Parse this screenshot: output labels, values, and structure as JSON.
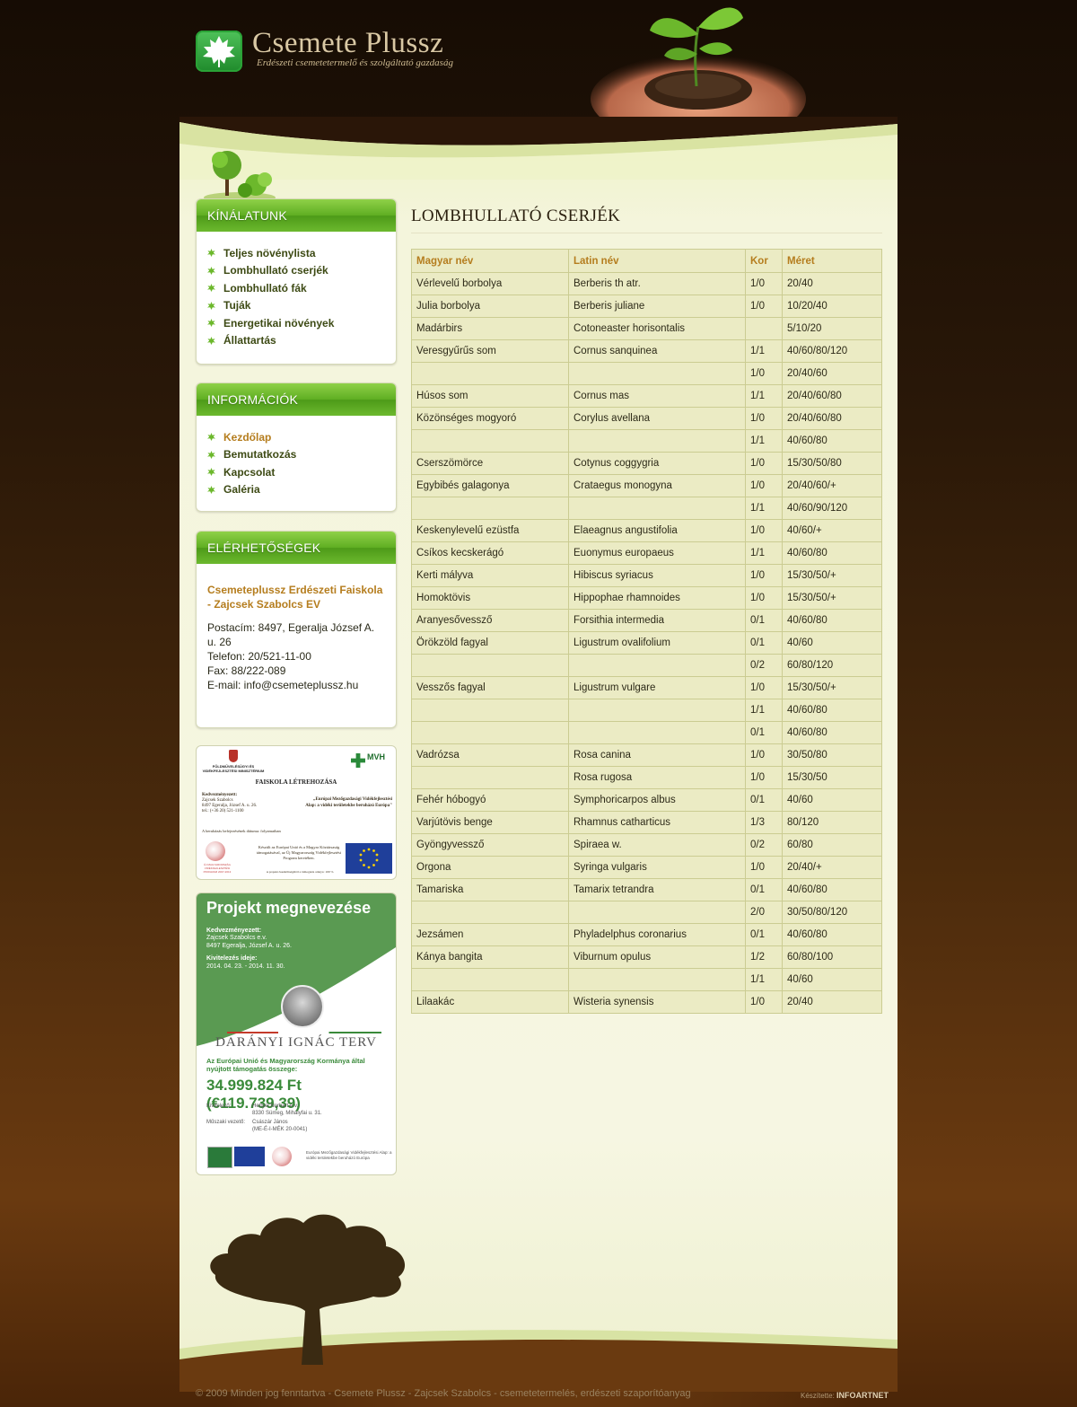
{
  "header": {
    "title": "Csemete Plussz",
    "subtitle": "Erdészeti csemetetermelő és szolgáltató gazdaság"
  },
  "colors": {
    "accent": "#b57d1e",
    "green": "#5fae22",
    "table_bg": "#ebebc4"
  },
  "sidebar": {
    "offer": {
      "title": "KÍNÁLATUNK",
      "items": [
        {
          "label": "Teljes növénylista"
        },
        {
          "label": "Lombhullató cserjék"
        },
        {
          "label": "Lombhullató fák"
        },
        {
          "label": "Tuják"
        },
        {
          "label": "Energetikai növények"
        },
        {
          "label": "Állattartás"
        }
      ]
    },
    "info": {
      "title": "INFORMÁCIÓK",
      "items": [
        {
          "label": "Kezdőlap",
          "active": true
        },
        {
          "label": "Bemutatkozás"
        },
        {
          "label": "Kapcsolat"
        },
        {
          "label": "Galéria"
        }
      ]
    },
    "contact": {
      "title": "ELÉRHETŐSÉGEK",
      "org": "Csemeteplussz Erdészeti Faiskola - Zajcsek Szabolcs EV",
      "lines": [
        "Postacím: 8497, Egeralja József A. u. 26",
        "Telefon: 20/521-11-00",
        "Fax: 88/222-089",
        "E-mail: info@csemeteplussz.hu"
      ]
    },
    "banner1": {
      "ministry": "FÖLDMŰVELÉSÜGYI ÉS VIDÉKFEJLESZTÉSI MINISZTÉRIUM",
      "mvh": "MVH",
      "heading": "FAISKOLA LÉTREHOZÁSA",
      "beneficiary_label": "Kedvezményezett:",
      "beneficiary": "Zajcsek Szabolcs",
      "address": "8497 Egeralja, József A. u. 26.",
      "phone": "tel.: (+36 20) 521-1100",
      "eu_fund": "„Európai Mezőgazdasági Vidékfejlesztési Alap: a vidéki területekbe beruházó Európa\"",
      "status": "A beruházás befejezésének dátuma: folyamatban",
      "program": "Készült az Európai Unió és a Magyar Köztársaság támogatásával, az Új Magyarország Vidékfejlesztési Program keretében.",
      "umvp": "ÚJ MAGYARORSZÁG VIDÉKFEJLESZTÉSI PROGRAM 2007-2013",
      "footnote": "A projekt összköltségéből a támogatás aránya: 100 %"
    },
    "banner2": {
      "title": "Projekt megnevezése",
      "beneficiary_label": "Kedvezményezett:",
      "beneficiary": "Zajcsek Szabolcs e.v.",
      "address": "8497 Egeralja, József A. u. 26.",
      "period_label": "Kivitelezés ideje:",
      "period": "2014. 04. 23. - 2014. 11. 30.",
      "plan": "DARÁNYI IGNÁC TERV",
      "support_text": "Az Európai Unió és Magyarország Kormánya által nyújtott támogatás összege:",
      "amount": "34.999.824 Ft (€119.739,39)",
      "contractor_label": "Kivitelező:",
      "contractor": "Hettyei Norbert e.v.",
      "contractor_addr": "8330 Sümeg, Mihályfai u. 31.",
      "tech_label": "Műszaki vezető:",
      "tech": "Császár János",
      "tech_id": "(ME-É-I-MÉK 20-0041)",
      "eu_text": "Európai Mezőgazdasági Vidékfejlesztési Alap: a vidéki területekbe beruházó Európa"
    }
  },
  "main": {
    "title": "LOMBHULLATÓ CSERJÉK",
    "columns": [
      "Magyar név",
      "Latin név",
      "Kor",
      "Méret"
    ],
    "rows": [
      [
        "Vérlevelű borbolya",
        "Berberis th atr.",
        "1/0",
        "20/40"
      ],
      [
        "Julia borbolya",
        "Berberis juliane",
        "1/0",
        "10/20/40"
      ],
      [
        "Madárbirs",
        "Cotoneaster horisontalis",
        "",
        "5/10/20"
      ],
      [
        "Veresgyűrűs som",
        "Cornus sanquinea",
        "1/1",
        "40/60/80/120"
      ],
      [
        "",
        "",
        "1/0",
        "20/40/60"
      ],
      [
        "Húsos som",
        "Cornus mas",
        "1/1",
        "20/40/60/80"
      ],
      [
        "Közönséges mogyoró",
        "Corylus avellana",
        "1/0",
        "20/40/60/80"
      ],
      [
        "",
        "",
        "1/1",
        "40/60/80"
      ],
      [
        "Cserszömörce",
        "Cotynus coggygria",
        "1/0",
        "15/30/50/80"
      ],
      [
        "Egybibés galagonya",
        "Crataegus monogyna",
        "1/0",
        "20/40/60/+"
      ],
      [
        "",
        "",
        "1/1",
        "40/60/90/120"
      ],
      [
        "Keskenylevelű ezüstfa",
        "Elaeagnus angustifolia",
        "1/0",
        "40/60/+"
      ],
      [
        "Csíkos kecskerágó",
        "Euonymus europaeus",
        "1/1",
        "40/60/80"
      ],
      [
        "Kerti mályva",
        "Hibiscus syriacus",
        "1/0",
        "15/30/50/+"
      ],
      [
        "Homoktövis",
        "Hippophae rhamnoides",
        "1/0",
        "15/30/50/+"
      ],
      [
        "Aranyesővessző",
        "Forsithia intermedia",
        "0/1",
        "40/60/80"
      ],
      [
        "Örökzöld fagyal",
        "Ligustrum ovalifolium",
        "0/1",
        "40/60"
      ],
      [
        "",
        "",
        "0/2",
        "60/80/120"
      ],
      [
        "Vesszős fagyal",
        "Ligustrum vulgare",
        "1/0",
        "15/30/50/+"
      ],
      [
        "",
        "",
        "1/1",
        "40/60/80"
      ],
      [
        "",
        "",
        "0/1",
        "40/60/80"
      ],
      [
        "Vadrózsa",
        "Rosa canina",
        "1/0",
        "30/50/80"
      ],
      [
        "",
        "Rosa rugosa",
        "1/0",
        "15/30/50"
      ],
      [
        "Fehér hóbogyó",
        "Symphoricarpos albus",
        "0/1",
        "40/60"
      ],
      [
        "Varjútövis benge",
        "Rhamnus catharticus",
        "1/3",
        "80/120"
      ],
      [
        "Gyöngyvessző",
        "Spiraea w.",
        "0/2",
        "60/80"
      ],
      [
        "Orgona",
        "Syringa vulgaris",
        "1/0",
        "20/40/+"
      ],
      [
        "Tamariska",
        "Tamarix tetrandra",
        "0/1",
        "40/60/80"
      ],
      [
        "",
        "",
        "2/0",
        "30/50/80/120"
      ],
      [
        "Jezsámen",
        "Phyladelphus coronarius",
        "0/1",
        "40/60/80"
      ],
      [
        "Kánya bangita",
        "Viburnum opulus",
        "1/2",
        "60/80/100"
      ],
      [
        "",
        "",
        "1/1",
        "40/60"
      ],
      [
        "Lilaakác",
        "Wisteria synensis",
        "1/0",
        "20/40"
      ]
    ]
  },
  "footer": {
    "copyright": "© 2009 Minden jog fenntartva - Csemete Plussz - Zajcsek Szabolcs - csemetetermelés, erdészeti szaporítóanyag",
    "credit_label": "Készítette:",
    "credit": "INFOARTNET"
  }
}
